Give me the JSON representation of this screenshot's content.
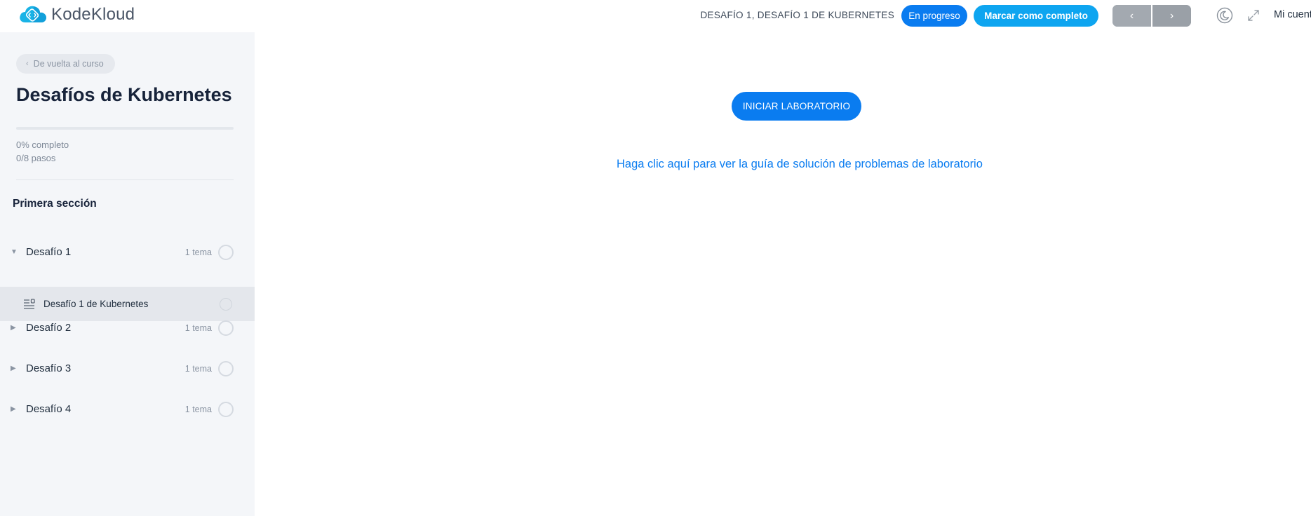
{
  "app": {
    "brand": "KodeKloud"
  },
  "header": {
    "lesson_title": "DESAFÍO 1, DESAFÍO 1 DE KUBERNETES",
    "status_badge": "En progreso",
    "mark_complete_label": "Marcar como completo",
    "prev_glyph": "‹",
    "next_glyph": "›",
    "account_label": "Mi cuent"
  },
  "colors": {
    "accent": "#0a7cf0",
    "complete_button": "#0ea5f0",
    "sidebar_bg": "#f4f6f9",
    "active_topic_bg": "#e4e7ec"
  },
  "icons": {
    "logo": "cloud-code-logo-icon",
    "back": "chevron-left-icon",
    "theme": "moon-icon",
    "fullscreen": "expand-icon",
    "topic": "text-lines-icon"
  },
  "sidebar": {
    "back_label": "De vuelta al curso",
    "course_title": "Desafíos de Kubernetes",
    "progress_fraction": 0,
    "progress_label": "0% completo",
    "steps_label": "0/8 pasos",
    "section_title": "Primera sección",
    "lessons": [
      {
        "name": "Desafío 1",
        "count": "1 tema",
        "expanded": true,
        "caret": "▼"
      },
      {
        "name": "Desafío 2",
        "count": "1 tema",
        "expanded": false,
        "caret": "▶"
      },
      {
        "name": "Desafío 3",
        "count": "1 tema",
        "expanded": false,
        "caret": "▶"
      },
      {
        "name": "Desafío 4",
        "count": "1 tema",
        "expanded": false,
        "caret": "▶"
      }
    ],
    "active_topic": {
      "name": "Desafío 1 de Kubernetes"
    }
  },
  "main": {
    "start_lab_label": "INICIAR LABORATORIO",
    "guide_link": "Haga clic aquí para ver la guía de solución de problemas de laboratorio"
  }
}
